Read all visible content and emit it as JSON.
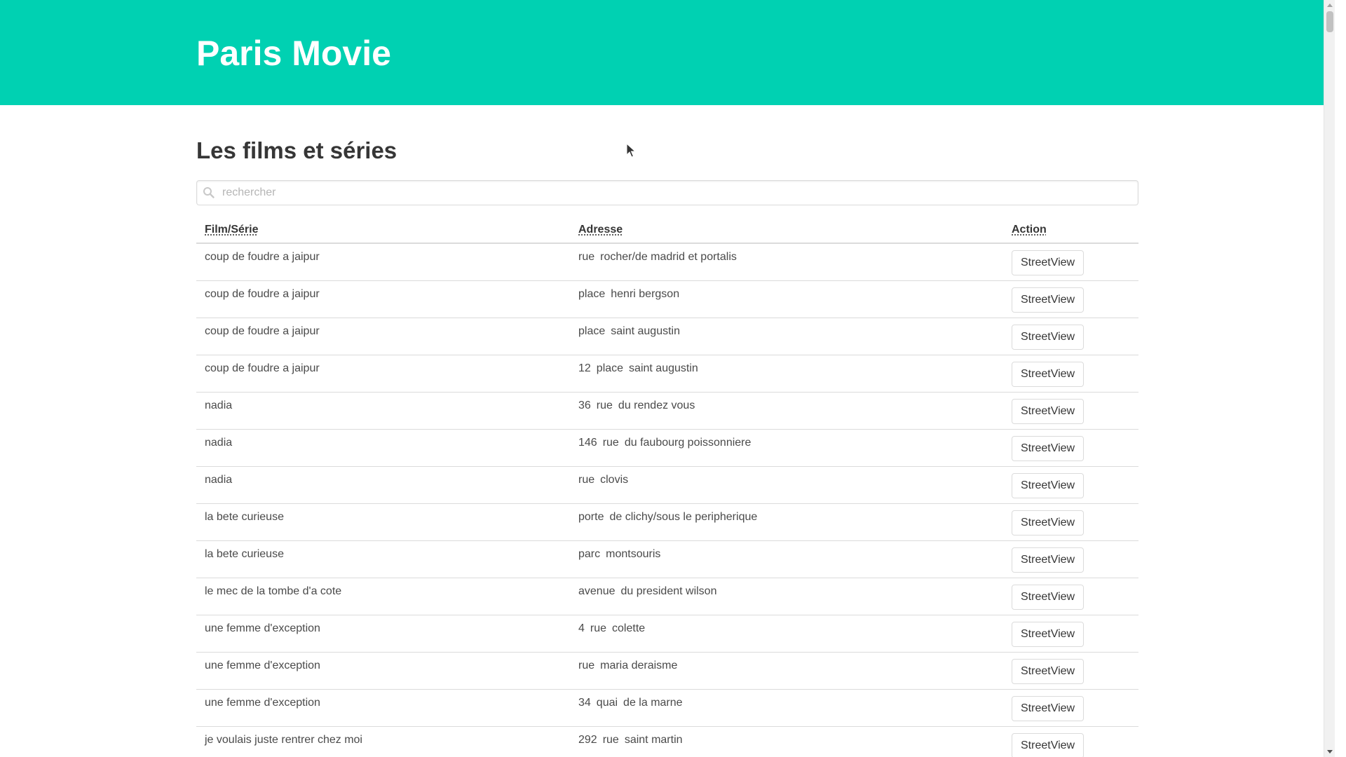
{
  "app": {
    "title": "Paris Movie",
    "brand_color": "#00d1b2"
  },
  "main": {
    "section_title": "Les films et séries",
    "search": {
      "placeholder": "rechercher",
      "value": ""
    },
    "table": {
      "headers": {
        "film": "Film/Série",
        "address": "Adresse",
        "action": "Action"
      },
      "rows": [
        {
          "film": "coup de foudre a jaipur",
          "address": [
            "rue",
            "rocher/de madrid et portalis"
          ],
          "action": "StreetView"
        },
        {
          "film": "coup de foudre a jaipur",
          "address": [
            "place",
            "henri bergson"
          ],
          "action": "StreetView"
        },
        {
          "film": "coup de foudre a jaipur",
          "address": [
            "place",
            "saint augustin"
          ],
          "action": "StreetView"
        },
        {
          "film": "coup de foudre a jaipur",
          "address": [
            "12",
            "place",
            "saint augustin"
          ],
          "action": "StreetView"
        },
        {
          "film": "nadia",
          "address": [
            "36",
            "rue",
            "du rendez vous"
          ],
          "action": "StreetView"
        },
        {
          "film": "nadia",
          "address": [
            "146",
            "rue",
            "du faubourg poissonniere"
          ],
          "action": "StreetView"
        },
        {
          "film": "nadia",
          "address": [
            "rue",
            "clovis"
          ],
          "action": "StreetView"
        },
        {
          "film": "la bete curieuse",
          "address": [
            "porte",
            "de clichy/sous le peripherique"
          ],
          "action": "StreetView"
        },
        {
          "film": "la bete curieuse",
          "address": [
            "parc",
            "montsouris"
          ],
          "action": "StreetView"
        },
        {
          "film": "le mec de la tombe d'a cote",
          "address": [
            "avenue",
            "du president wilson"
          ],
          "action": "StreetView"
        },
        {
          "film": "une femme d'exception",
          "address": [
            "4",
            "rue",
            "colette"
          ],
          "action": "StreetView"
        },
        {
          "film": "une femme d'exception",
          "address": [
            "rue",
            "maria deraisme"
          ],
          "action": "StreetView"
        },
        {
          "film": "une femme d'exception",
          "address": [
            "34",
            "quai",
            "de la marne"
          ],
          "action": "StreetView"
        },
        {
          "film": "je voulais juste rentrer chez moi",
          "address": [
            "292",
            "rue",
            "saint martin"
          ],
          "action": "StreetView"
        }
      ]
    }
  },
  "icons": {
    "search": "search-icon",
    "cursor": "mouse-cursor-icon"
  }
}
